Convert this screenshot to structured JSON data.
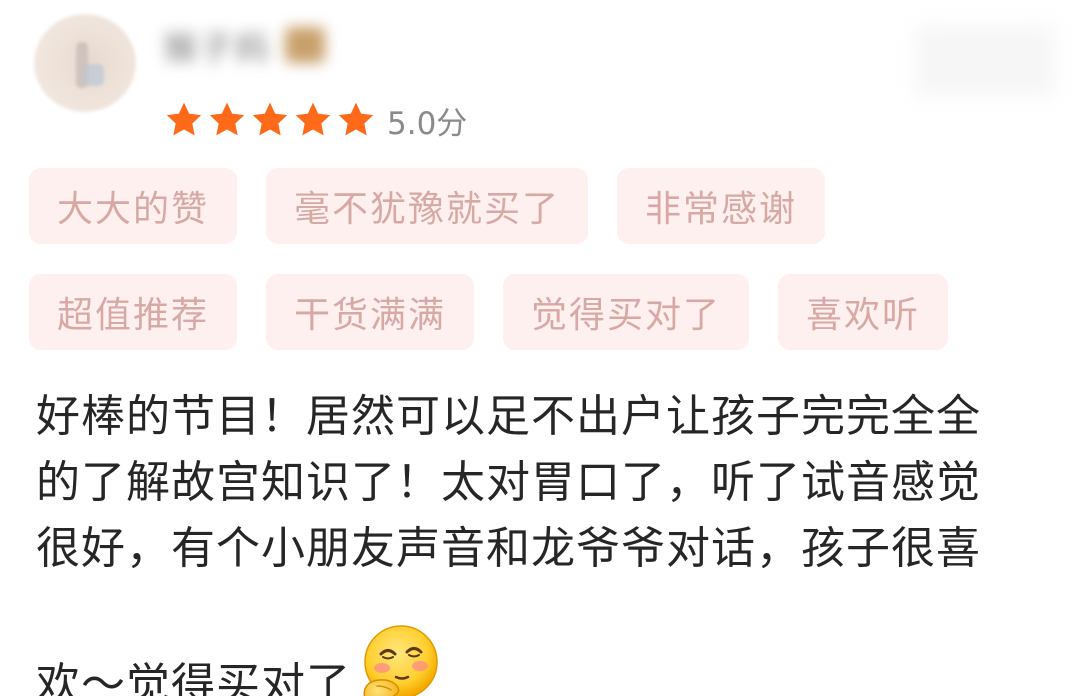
{
  "review": {
    "user": {
      "name_obscured": "猴子妈",
      "avatar": "avatar-photo-blurred",
      "badge": "vip-badge-blurred"
    },
    "rating": {
      "stars": 5,
      "max_stars": 5,
      "score_text": "5.0分",
      "star_color": "#ff6a1a"
    },
    "tags": {
      "row1": [
        "大大的赞",
        "毫不犹豫就买了",
        "非常感谢"
      ],
      "row2": [
        "超值推荐",
        "干货满满",
        "觉得买对了",
        "喜欢听"
      ]
    },
    "text_lines": [
      "好棒的节目！居然可以足不出户让孩子完完全全",
      "的了解故宫知识了！太对胃口了，听了试音感觉",
      "很好，有个小朋友声音和龙爷爷对话，孩子很喜",
      "欢～觉得买对了"
    ],
    "trailing_emoji": "thinking-blushing-emoji-icon"
  },
  "colors": {
    "tag_background": "#fdf0ee",
    "tag_text": "#d8a8a4",
    "body_text": "#262626",
    "score_text": "#8a8a8a"
  }
}
